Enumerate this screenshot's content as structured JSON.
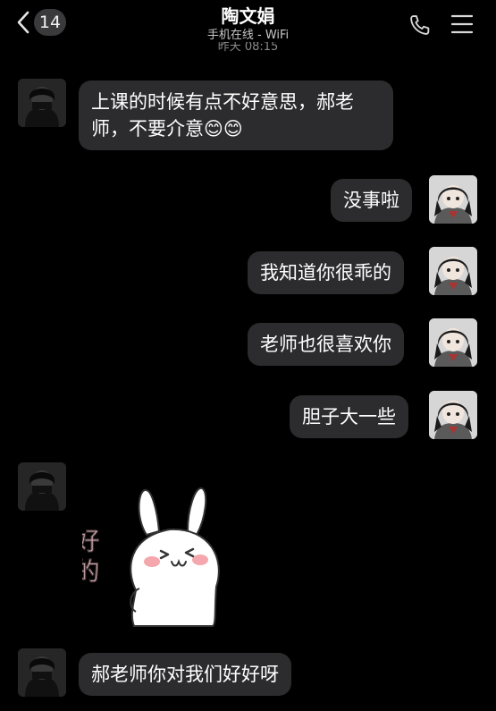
{
  "header": {
    "unread_count": "14",
    "contact_name": "陶文娟",
    "status": "手机在线 - WiFi",
    "time_partial": "昨天 08:15"
  },
  "messages": [
    {
      "side": "left",
      "text": "上课的时候有点不好意思，郝老师，不要介意😊😊"
    },
    {
      "side": "right",
      "text": "没事啦"
    },
    {
      "side": "right",
      "text": "我知道你很乖的"
    },
    {
      "side": "right",
      "text": "老师也很喜欢你"
    },
    {
      "side": "right",
      "text": "胆子大一些"
    },
    {
      "side": "left",
      "type": "sticker",
      "text": "好的"
    },
    {
      "side": "left",
      "text": "郝老师你对我们好好呀"
    }
  ],
  "colors": {
    "background": "#000000",
    "bubble": "#2c2c2e",
    "text": "#ffffff",
    "badge": "#3a3a3c"
  },
  "icons": {
    "back": "chevron-left-icon",
    "call": "phone-icon",
    "menu": "hamburger-menu-icon"
  }
}
